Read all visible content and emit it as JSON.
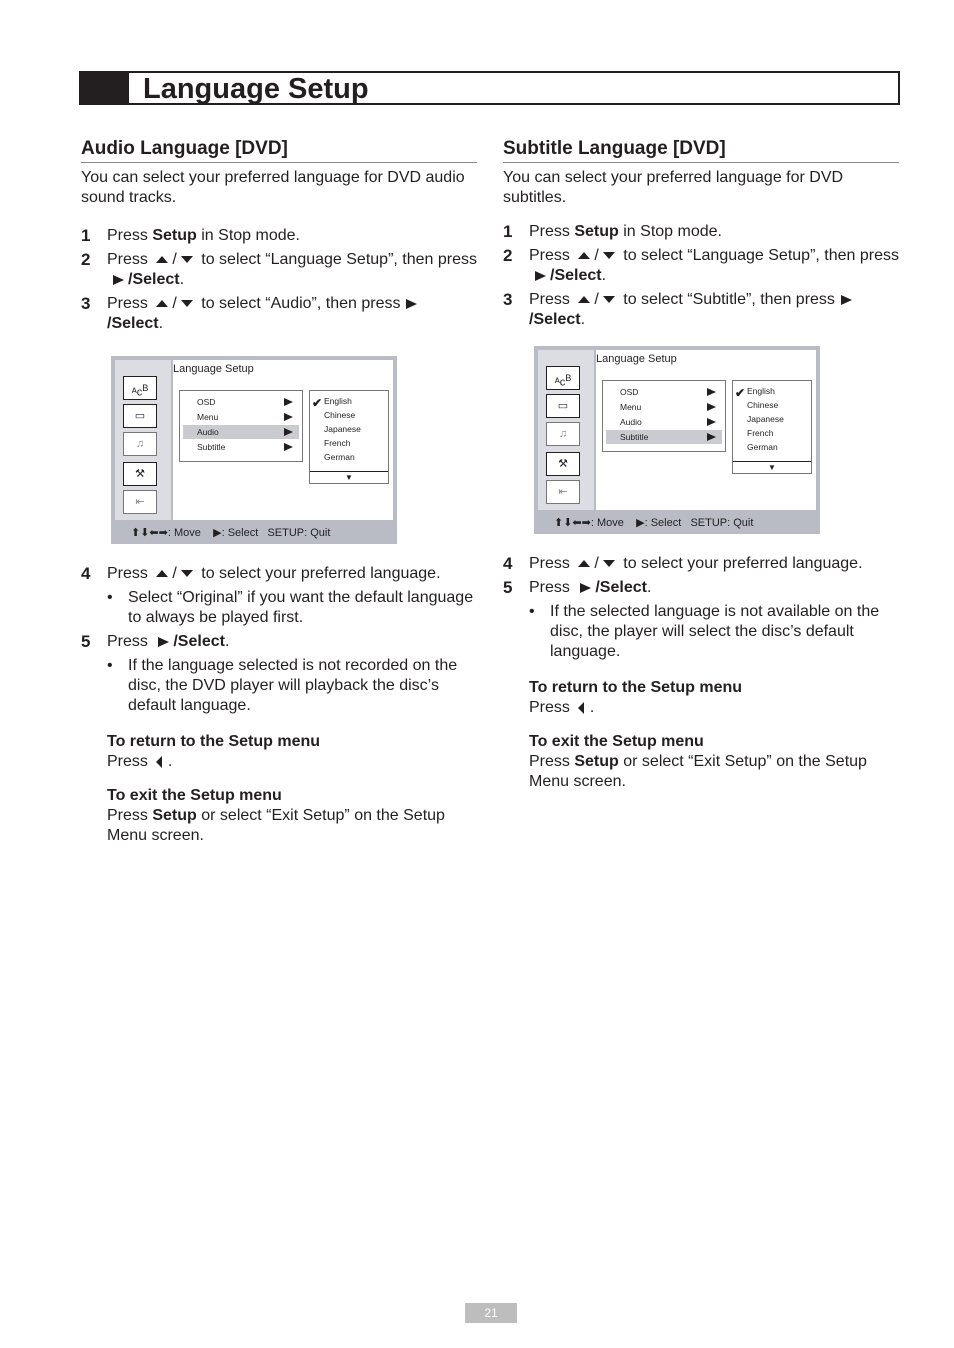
{
  "page": {
    "title": "Language Setup",
    "page_number": "21"
  },
  "audio": {
    "heading": "Audio Language [DVD]",
    "intro": "You can select your preferred language for DVD audio sound tracks.",
    "step1": {
      "num": "1",
      "a": "Press ",
      "b": "Setup",
      "c": " in Stop mode."
    },
    "step2": {
      "num": "2",
      "a": "Press",
      "sep": "/",
      "c": " to select “Language Setup”, then press",
      "d": "/Select",
      "e": "."
    },
    "step3": {
      "num": "3",
      "a": "Press",
      "sep": "/",
      "c": " to select “Audio”, then press",
      "d": "/Select",
      "e": "."
    },
    "step4": {
      "num": "4",
      "a": "Press",
      "sep": "/",
      "c": " to select your preferred language."
    },
    "bullet4": "Select “Original” if you want the default language to always be played first.",
    "step5": {
      "num": "5",
      "a": "Press",
      "d": "/Select",
      "e": "."
    },
    "bullet5": "If the language selected is not recorded on the disc, the DVD player will playback the disc’s default language.",
    "return": {
      "heading": "To return to the Setup menu",
      "a": "Press",
      "e": "."
    },
    "exit": {
      "heading": "To exit the Setup menu",
      "a": "Press ",
      "b": "Setup",
      "c": " or select “Exit Setup” on the Setup Menu screen."
    },
    "osd": {
      "title": "Language Setup",
      "menu": [
        "OSD",
        "Menu",
        "Audio",
        "Subtitle"
      ],
      "selected": "Audio",
      "languages": [
        "English",
        "Chinese",
        "Japanese",
        "French",
        "German"
      ],
      "checked": "English",
      "footer": {
        "move": ": Move",
        "select": ": Select",
        "quit": "SETUP: Quit"
      }
    }
  },
  "subtitle": {
    "heading": "Subtitle Language [DVD]",
    "intro": "You can select your preferred language for DVD subtitles.",
    "step1": {
      "num": "1",
      "a": "Press ",
      "b": "Setup",
      "c": " in Stop mode."
    },
    "step2": {
      "num": "2",
      "a": "Press",
      "sep": "/",
      "c": " to select “Language Setup”, then press",
      "d": "/Select",
      "e": "."
    },
    "step3": {
      "num": "3",
      "a": "Press",
      "sep": "/",
      "c": " to select “Subtitle”, then press",
      "d": "/Select",
      "e": "."
    },
    "step4": {
      "num": "4",
      "a": "Press",
      "sep": "/",
      "c": " to select your preferred language."
    },
    "step5": {
      "num": "5",
      "a": "Press",
      "d": "/Select",
      "e": "."
    },
    "bullet5": "If the selected language is not available on the disc, the player will select the disc’s default language.",
    "return": {
      "heading": "To return to the Setup menu",
      "a": "Press",
      "e": "."
    },
    "exit": {
      "heading": "To exit the Setup menu",
      "a": "Press ",
      "b": "Setup",
      "c": " or select “Exit Setup” on the Setup Menu screen."
    },
    "osd": {
      "title": "Language Setup",
      "menu": [
        "OSD",
        "Menu",
        "Audio",
        "Subtitle"
      ],
      "selected": "Subtitle",
      "languages": [
        "English",
        "Chinese",
        "Japanese",
        "French",
        "German"
      ],
      "checked": "English",
      "footer": {
        "move": ": Move",
        "select": ": Select",
        "quit": "SETUP: Quit"
      }
    }
  }
}
